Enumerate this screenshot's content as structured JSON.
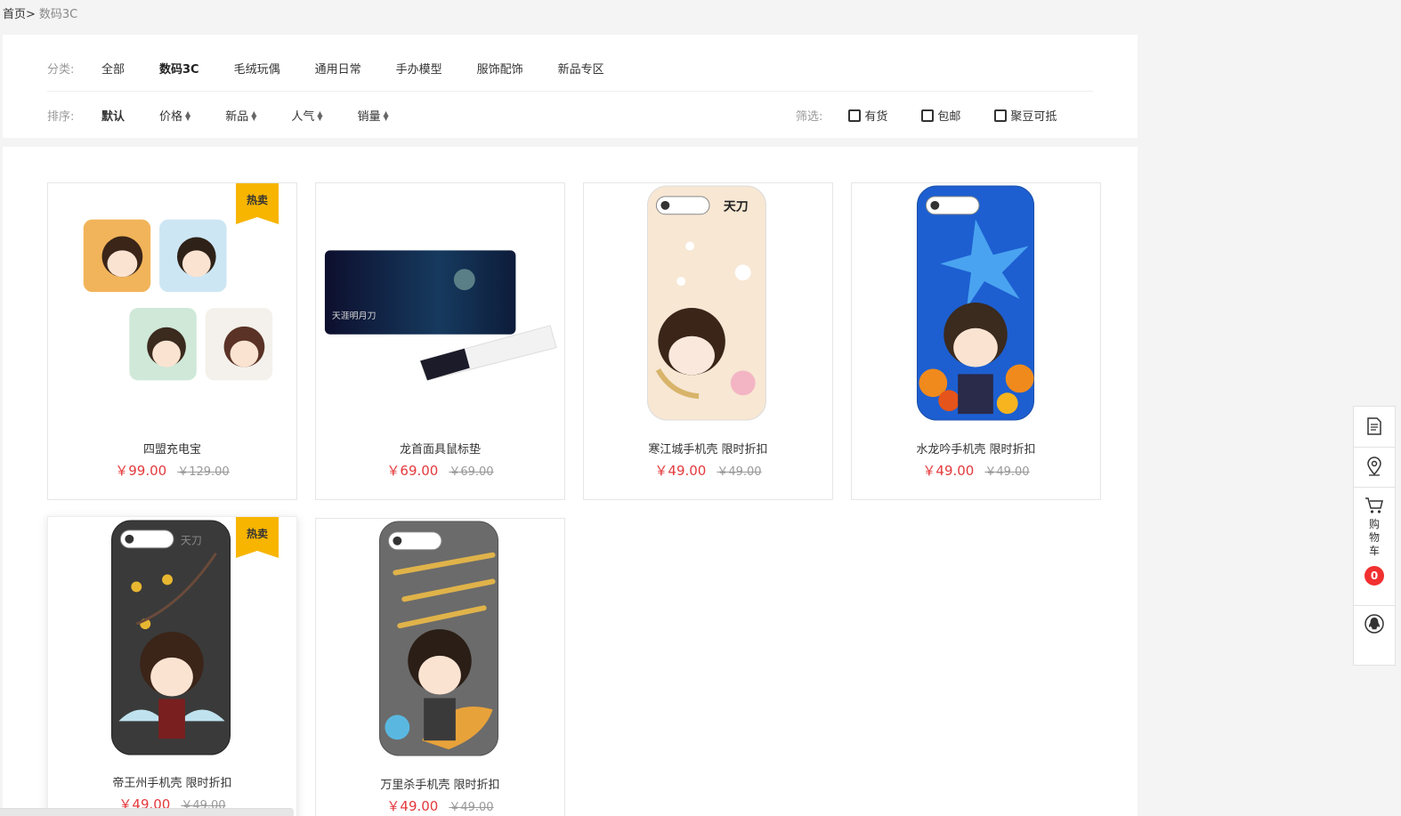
{
  "breadcrumb": {
    "home": "首页>",
    "current": "数码3C"
  },
  "filters": {
    "category_label": "分类:",
    "categories": [
      "全部",
      "数码3C",
      "毛绒玩偶",
      "通用日常",
      "手办模型",
      "服饰配饰",
      "新品专区"
    ],
    "active_category": "数码3C",
    "sort_label": "排序:",
    "sorts": [
      "默认",
      "价格",
      "新品",
      "人气",
      "销量"
    ],
    "screen_label": "筛选:",
    "checks": [
      "有货",
      "包邮",
      "聚豆可抵"
    ]
  },
  "products": [
    {
      "name": "四盟充电宝",
      "price": "￥99.00",
      "original": "￥129.00",
      "hot": "热卖",
      "image": "power-bank"
    },
    {
      "name": "龙首面具鼠标垫",
      "price": "￥69.00",
      "original": "￥69.00",
      "hot": "",
      "image": "mouse-pad"
    },
    {
      "name": "寒江城手机壳 限时折扣",
      "price": "￥49.00",
      "original": "￥49.00",
      "hot": "",
      "image": "phone-case-cream"
    },
    {
      "name": "水龙吟手机壳 限时折扣",
      "price": "￥49.00",
      "original": "￥49.00",
      "hot": "",
      "image": "phone-case-blue"
    },
    {
      "name": "帝王州手机壳 限时折扣",
      "price": "￥49.00",
      "original": "￥49.00",
      "hot": "热卖",
      "image": "phone-case-black"
    },
    {
      "name": "万里杀手机壳 限时折扣",
      "price": "￥49.00",
      "original": "￥49.00",
      "hot": "",
      "image": "phone-case-grey"
    }
  ],
  "sidebar": {
    "cart_label": "购物车",
    "cart_chars": [
      "购",
      "物",
      "车"
    ],
    "cart_count": "0",
    "icons": [
      "document-icon",
      "location-pin-icon",
      "cart-icon",
      "qq-penguin-icon"
    ]
  },
  "colors": {
    "price": "#e4393c",
    "hot_badge": "#f7b500",
    "cart_badge": "#f23030"
  }
}
